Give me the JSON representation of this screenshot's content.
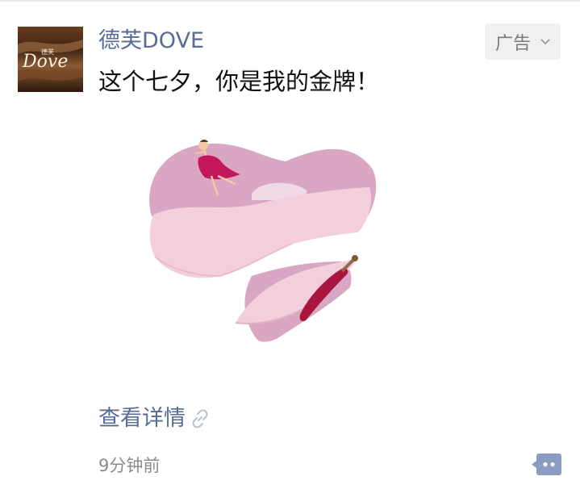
{
  "post": {
    "account_name": "德芙DOVE",
    "ad_tag": "广告",
    "text": "这个七夕，你是我的金牌！",
    "details_link": "查看详情",
    "timestamp": "9分钟前"
  },
  "avatar": {
    "logo_text": "Dove",
    "logo_subtext": "德芙"
  },
  "icons": {
    "ad_tag_dropdown": "chevron-down-icon",
    "details_link": "link-icon",
    "comment": "comment-icon"
  },
  "colors": {
    "link_blue": "#576b95",
    "heart_pink": "#d9a6c4",
    "heart_pale": "#f3cfdb",
    "avatar_brown": "#4a2a17",
    "dress_red": "#c2185b"
  }
}
